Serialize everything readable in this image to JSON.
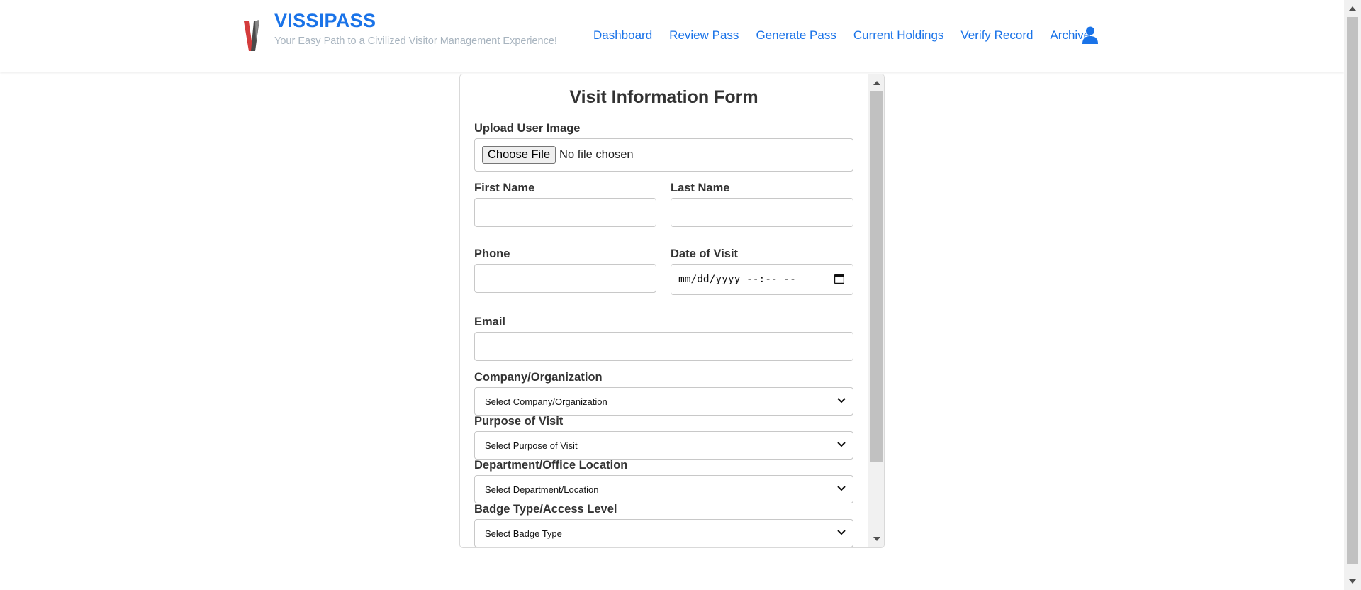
{
  "brand": {
    "title": "VISSIPASS",
    "tagline": "Your Easy Path to a Civilized Visitor Management Experience!"
  },
  "nav": {
    "items": [
      {
        "label": "Dashboard"
      },
      {
        "label": "Review Pass"
      },
      {
        "label": "Generate Pass"
      },
      {
        "label": "Current Holdings"
      },
      {
        "label": "Verify Record"
      },
      {
        "label": "Archive"
      }
    ],
    "user_icon": "user-icon"
  },
  "form": {
    "title": "Visit Information Form",
    "upload": {
      "label": "Upload User Image",
      "button": "Choose File",
      "status": "No file chosen"
    },
    "first_name": {
      "label": "First Name",
      "value": ""
    },
    "last_name": {
      "label": "Last Name",
      "value": ""
    },
    "phone": {
      "label": "Phone",
      "value": ""
    },
    "date_of_visit": {
      "label": "Date of Visit",
      "placeholder": "mm/dd/yyyy --:-- --"
    },
    "email": {
      "label": "Email",
      "value": ""
    },
    "company": {
      "label": "Company/Organization",
      "selected": "Select Company/Organization"
    },
    "purpose": {
      "label": "Purpose of Visit",
      "selected": "Select Purpose of Visit"
    },
    "department": {
      "label": "Department/Office Location",
      "selected": "Select Department/Location"
    },
    "badge": {
      "label": "Badge Type/Access Level",
      "selected": "Select Badge Type"
    }
  },
  "colors": {
    "accent": "#1a73e8",
    "tagline": "#a8b4bf"
  }
}
